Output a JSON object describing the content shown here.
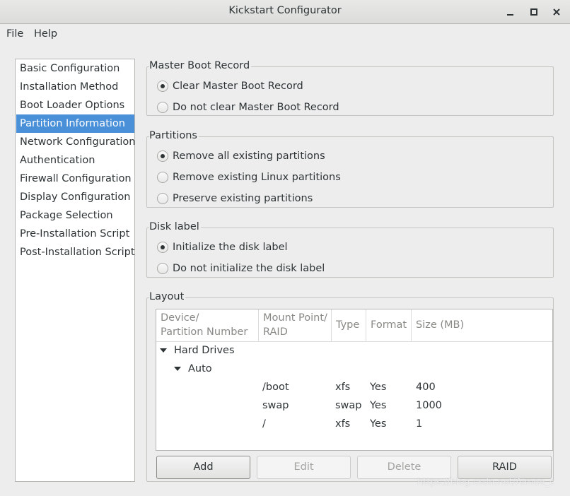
{
  "window": {
    "title": "Kickstart Configurator"
  },
  "menubar": {
    "items": [
      "File",
      "Help"
    ]
  },
  "sidebar": {
    "items": [
      "Basic Configuration",
      "Installation Method",
      "Boot Loader Options",
      "Partition Information",
      "Network Configuration",
      "Authentication",
      "Firewall Configuration",
      "Display Configuration",
      "Package Selection",
      "Pre-Installation Script",
      "Post-Installation Script"
    ],
    "selected": "Partition Information"
  },
  "mbr": {
    "title": "Master Boot Record",
    "options": [
      "Clear Master Boot Record",
      "Do not clear Master Boot Record"
    ],
    "selected": "Clear Master Boot Record"
  },
  "partitions": {
    "title": "Partitions",
    "options": [
      "Remove all existing partitions",
      "Remove existing Linux partitions",
      "Preserve existing partitions"
    ],
    "selected": "Remove all existing partitions"
  },
  "disklabel": {
    "title": "Disk label",
    "options": [
      "Initialize the disk label",
      "Do not initialize the disk label"
    ],
    "selected": "Initialize the disk label"
  },
  "layout": {
    "title": "Layout",
    "columns": [
      [
        "Device/",
        "Partition Number"
      ],
      [
        "Mount Point/",
        "RAID"
      ],
      [
        "Type"
      ],
      [
        "Format"
      ],
      [
        "Size (MB)"
      ]
    ],
    "tree": {
      "root": "Hard Drives",
      "child": "Auto",
      "rows": [
        {
          "mount": "/boot",
          "type": "xfs",
          "format": "Yes",
          "size": "400"
        },
        {
          "mount": "swap",
          "type": "swap",
          "format": "Yes",
          "size": "1000"
        },
        {
          "mount": "/",
          "type": "xfs",
          "format": "Yes",
          "size": "1"
        }
      ]
    },
    "buttons": {
      "add": "Add",
      "edit": "Edit",
      "delete": "Delete",
      "raid": "RAID"
    }
  },
  "watermark": "https://blog.csdn.net/Aimee_c",
  "colors": {
    "selection": "#4a90d9",
    "background": "#ededed"
  }
}
